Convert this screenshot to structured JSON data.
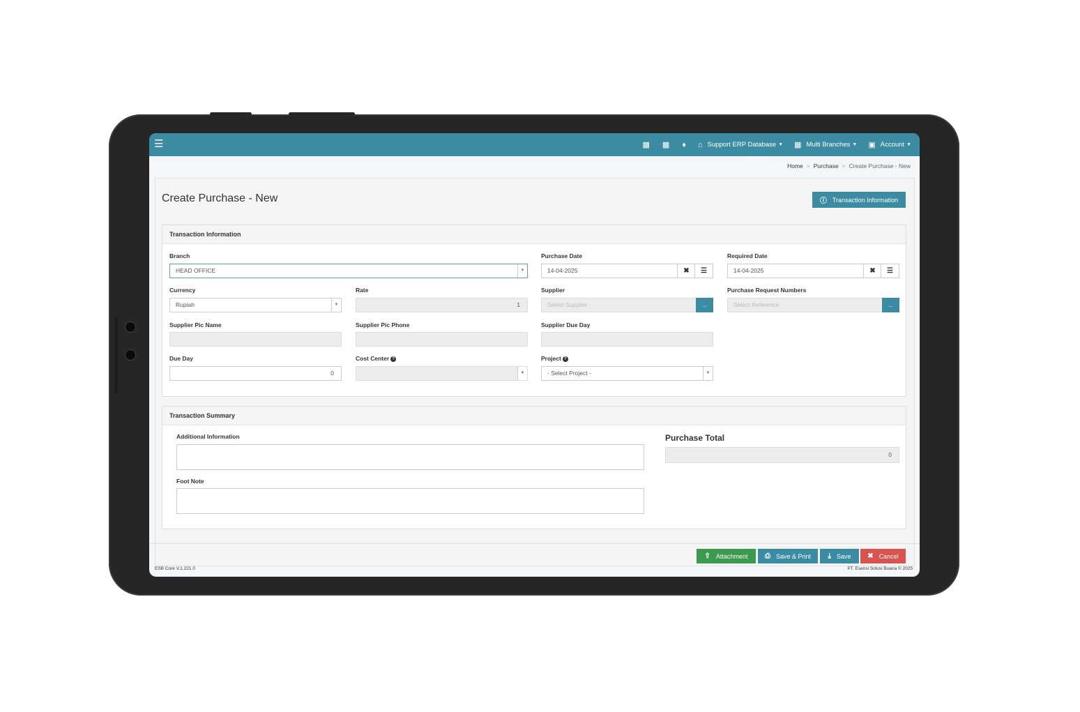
{
  "topbar": {
    "menu_icon": "hamburger-icon",
    "database_label": "Support ERP Database",
    "branches_label": "Multi Branches",
    "account_label": "Account"
  },
  "breadcrumb": {
    "home": "Home",
    "purchase": "Purchase",
    "current": "Create Purchase - New"
  },
  "page": {
    "title": "Create Purchase - New",
    "info_button": "Transaction Information"
  },
  "transaction_info": {
    "header": "Transaction Information",
    "branch": {
      "label": "Branch",
      "value": "HEAD OFFICE"
    },
    "purchase_date": {
      "label": "Purchase Date",
      "value": "14-04-2025"
    },
    "required_date": {
      "label": "Required Date",
      "value": "14-04-2025"
    },
    "currency": {
      "label": "Currency",
      "value": "Rupiah"
    },
    "rate": {
      "label": "Rate",
      "value": "1"
    },
    "supplier": {
      "label": "Supplier",
      "placeholder": "Select Supplier"
    },
    "pr_numbers": {
      "label": "Purchase Request Numbers",
      "placeholder": "Select Reference"
    },
    "supplier_pic_name": {
      "label": "Supplier Pic Name",
      "value": ""
    },
    "supplier_pic_phone": {
      "label": "Supplier Pic Phone",
      "value": ""
    },
    "supplier_due_day": {
      "label": "Supplier Due Day",
      "value": ""
    },
    "due_day": {
      "label": "Due Day",
      "value": "0"
    },
    "cost_center": {
      "label": "Cost Center",
      "value": ""
    },
    "project": {
      "label": "Project",
      "value": "- Select Project -"
    }
  },
  "summary": {
    "header": "Transaction Summary",
    "additional_info_label": "Additional Information",
    "foot_note_label": "Foot Note",
    "purchase_total_label": "Purchase Total",
    "purchase_total_value": "0"
  },
  "actions": {
    "attachment": "Attachment",
    "save_print": "Save & Print",
    "save": "Save",
    "cancel": "Cancel"
  },
  "footer": {
    "version": "ESB Core V.1.221.0",
    "copyright": "PT. Esensi Solusi Buana © 2025"
  },
  "colors": {
    "primary": "#3b8ba2",
    "success": "#3c9a4f",
    "danger": "#d9534f"
  }
}
